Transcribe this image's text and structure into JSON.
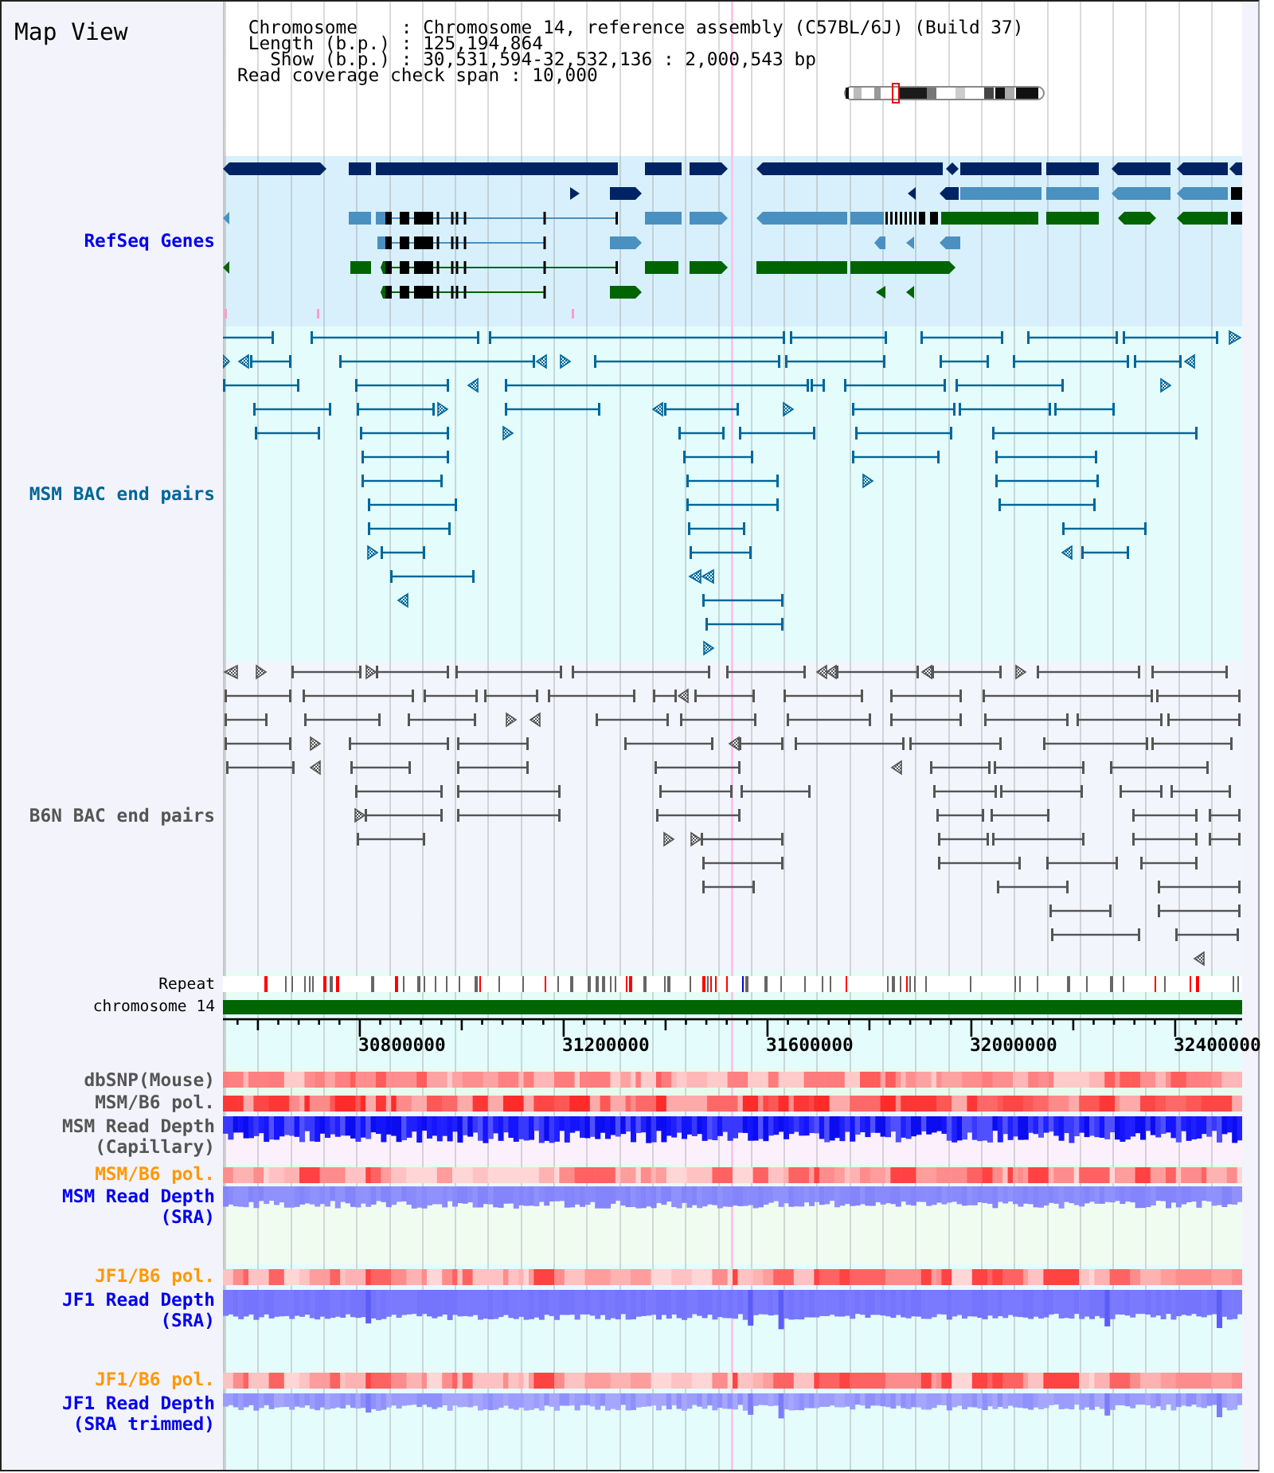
{
  "title": "Map View",
  "info_lines": [
    "Chromosome    : Chromosome 14, reference assembly (C57BL/6J) (Build 37)",
    "Length (b.p.) : 125,194,864",
    "Show (b.p.) : 30,531,594-32,532,136 : 2,000,543 bp",
    "Read coverage check span : 10,000"
  ],
  "tracks": [
    {
      "kind": "genes",
      "label": "RefSeq Genes",
      "color": "#0000ee"
    },
    {
      "kind": "bac_pairs",
      "label": "MSM BAC end pairs",
      "color": "#006699"
    },
    {
      "kind": "bac_pairs",
      "label": "B6N BAC end pairs",
      "color": "#555555"
    },
    {
      "kind": "repeat",
      "label": "Repeat",
      "color": "#000000"
    },
    {
      "kind": "chromosome",
      "label": "chromosome 14",
      "color": "#000000"
    },
    {
      "kind": "axis",
      "ticks": [
        "30800000",
        "31200000",
        "31600000",
        "32000000",
        "32400000"
      ]
    },
    {
      "kind": "heatmap",
      "label": "dbSNP(Mouse)",
      "color": "#555555"
    },
    {
      "kind": "heatmap",
      "label": "MSM/B6 pol.",
      "color": "#555555"
    },
    {
      "kind": "depth",
      "label": "MSM Read Depth",
      "sublabel": "(Capillary)",
      "color": "#555555"
    },
    {
      "kind": "heatmap",
      "label": "MSM/B6 pol.",
      "color": "#ff9900"
    },
    {
      "kind": "depth",
      "label": "MSM Read Depth",
      "sublabel": "(SRA)",
      "color": "#0000ee"
    },
    {
      "kind": "heatmap",
      "label": "JF1/B6 pol.",
      "color": "#ff9900"
    },
    {
      "kind": "depth",
      "label": "JF1 Read Depth",
      "sublabel": "(SRA)",
      "color": "#0000ee"
    },
    {
      "kind": "heatmap",
      "label": "JF1/B6 pol.",
      "color": "#ff9900"
    },
    {
      "kind": "depth",
      "label": "JF1 Read Depth",
      "sublabel": "(SRA trimmed)",
      "color": "#0000ee"
    }
  ]
}
